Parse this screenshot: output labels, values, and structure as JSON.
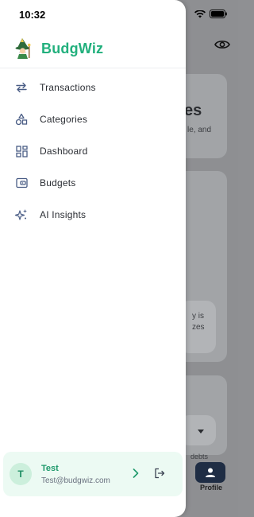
{
  "status_bar": {
    "time": "10:32"
  },
  "brand": {
    "name": "BudgWiz",
    "accent_color": "#22b07d"
  },
  "nav": {
    "items": [
      {
        "label": "Transactions",
        "icon": "arrows-swap-icon"
      },
      {
        "label": "Categories",
        "icon": "shapes-icon"
      },
      {
        "label": "Dashboard",
        "icon": "grid-icon"
      },
      {
        "label": "Budgets",
        "icon": "wallet-icon"
      },
      {
        "label": "AI Insights",
        "icon": "sparkles-icon"
      }
    ]
  },
  "user": {
    "initial": "T",
    "name": "Test",
    "email": "Test@budgwiz.com"
  },
  "background": {
    "heading_fragment": "es",
    "text_fragment_1": "le, and",
    "text_fragment_2": "y is",
    "text_fragment_3": "zes",
    "text_fragment_4": "debts",
    "tab_label": "Profile"
  }
}
